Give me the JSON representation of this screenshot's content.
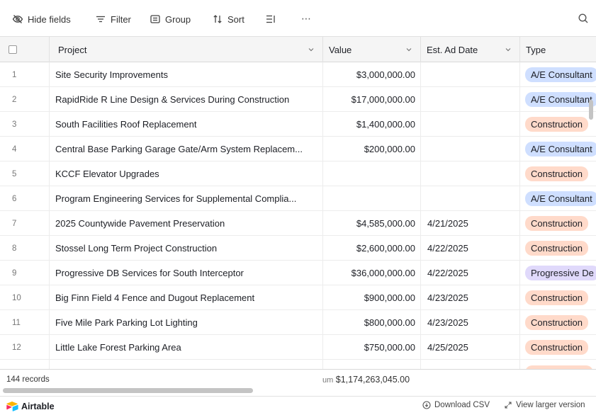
{
  "toolbar": {
    "hide_fields": "Hide fields",
    "filter": "Filter",
    "group": "Group",
    "sort": "Sort",
    "more": "⋯"
  },
  "columns": {
    "project": "Project",
    "value": "Value",
    "est_ad_date": "Est. Ad Date",
    "type": "Type"
  },
  "rows": [
    {
      "num": "1",
      "project": "Site Security Improvements",
      "value": "$3,000,000.00",
      "date": "",
      "type": "A/E Consultant",
      "type_kind": "ae"
    },
    {
      "num": "2",
      "project": "RapidRide R Line Design & Services During Construction",
      "value": "$17,000,000.00",
      "date": "",
      "type": "A/E Consultant",
      "type_kind": "ae"
    },
    {
      "num": "3",
      "project": "South Facilities Roof Replacement",
      "value": "$1,400,000.00",
      "date": "",
      "type": "Construction",
      "type_kind": "con"
    },
    {
      "num": "4",
      "project": "Central Base Parking Garage Gate/Arm System Replacem...",
      "value": "$200,000.00",
      "date": "",
      "type": "A/E Consultant",
      "type_kind": "ae"
    },
    {
      "num": "5",
      "project": "KCCF Elevator Upgrades",
      "value": "",
      "date": "",
      "type": "Construction",
      "type_kind": "con"
    },
    {
      "num": "6",
      "project": "Program Engineering Services for Supplemental Complia...",
      "value": "",
      "date": "",
      "type": "A/E Consultant",
      "type_kind": "ae"
    },
    {
      "num": "7",
      "project": "2025 Countywide Pavement Preservation",
      "value": "$4,585,000.00",
      "date": "4/21/2025",
      "type": "Construction",
      "type_kind": "con"
    },
    {
      "num": "8",
      "project": "Stossel Long Term Project Construction",
      "value": "$2,600,000.00",
      "date": "4/22/2025",
      "type": "Construction",
      "type_kind": "con"
    },
    {
      "num": "9",
      "project": "Progressive DB Services for South Interceptor",
      "value": "$36,000,000.00",
      "date": "4/22/2025",
      "type": "Progressive De",
      "type_kind": "prog"
    },
    {
      "num": "10",
      "project": "Big Finn Field 4 Fence and Dugout Replacement",
      "value": "$900,000.00",
      "date": "4/23/2025",
      "type": "Construction",
      "type_kind": "con"
    },
    {
      "num": "11",
      "project": "Five Mile Park Parking Lot Lighting",
      "value": "$800,000.00",
      "date": "4/23/2025",
      "type": "Construction",
      "type_kind": "con"
    },
    {
      "num": "12",
      "project": "Little Lake Forest Parking Area",
      "value": "$750,000.00",
      "date": "4/25/2025",
      "type": "Construction",
      "type_kind": "con"
    }
  ],
  "type_colors": {
    "ae": "#cfdfff",
    "con": "#ffdaca",
    "prog": "#e0d9fb"
  },
  "footer": {
    "records": "144 records",
    "sum_label": "um",
    "sum_value": "$1,174,263,045.00"
  },
  "bottombar": {
    "brand": "Airtable",
    "download": "Download CSV",
    "view_larger": "View larger version"
  }
}
